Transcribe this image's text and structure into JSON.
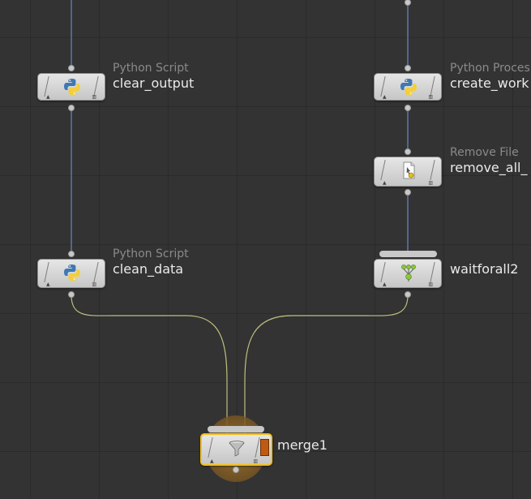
{
  "colors": {
    "background": "#333333",
    "wire_blue": "#6a88c8",
    "wire_merge": "#bfbf80",
    "selection": "#f0c020",
    "display_flag": "#c05a10"
  },
  "nodes": {
    "clear_output": {
      "type": "Python Script",
      "name": "clear_output",
      "icon": "python-icon"
    },
    "create_work": {
      "type": "Python Proces",
      "name": "create_work",
      "icon": "python-icon"
    },
    "remove_all": {
      "type": "Remove File",
      "name": "remove_all_",
      "icon": "remove-file-icon"
    },
    "clean_data": {
      "type": "Python Script",
      "name": "clean_data",
      "icon": "python-icon"
    },
    "waitforall2": {
      "type": "",
      "name": "waitforall2",
      "icon": "waitforall-icon"
    },
    "merge1": {
      "type": "",
      "name": "merge1",
      "icon": "funnel-icon",
      "selected": true
    }
  }
}
